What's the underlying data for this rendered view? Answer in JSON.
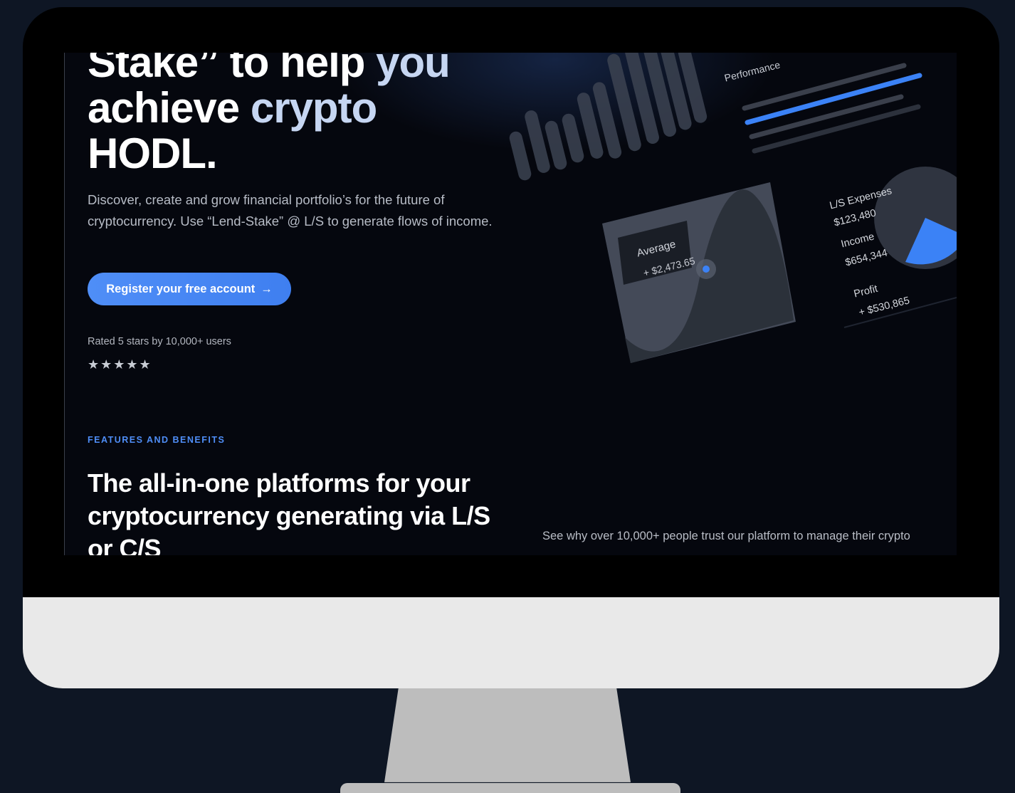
{
  "hero": {
    "headline_line1_white": "Stake” to help ",
    "headline_line1_accent": "you",
    "headline_line2_white": "achieve ",
    "headline_line2_accent": "crypto",
    "headline_line3": "HODL.",
    "lead": "Discover, create and grow financial portfolio’s for the future of cryptocurrency. Use “Lend-Stake” @ L/S to generate flows of income.",
    "cta_label": "Register your free account",
    "cta_arrow": "→",
    "rating_text": "Rated 5 stars by 10,000+ users",
    "stars": "★★★★★",
    "rating_value": 5
  },
  "dashboard": {
    "performance_label": "Performance",
    "average_label": "Average",
    "average_value": "+ $2,473.65",
    "expenses_label": "L/S Expenses",
    "expenses_value": "$123,480",
    "income_label": "Income",
    "income_value": "$654,344",
    "profit_label": "Profit",
    "profit_value": "+ $530,865"
  },
  "features": {
    "eyebrow": "FEATURES AND BENEFITS",
    "title": "The all-in-one platforms for your cryptocurrency generating via L/S or C/S",
    "trust_text": "See why over 10,000+ people trust our platform to manage their crypto"
  },
  "colors": {
    "accent_blue": "#4f8ef7",
    "background": "#05070e",
    "headline_accent": "#c6d6f2"
  }
}
